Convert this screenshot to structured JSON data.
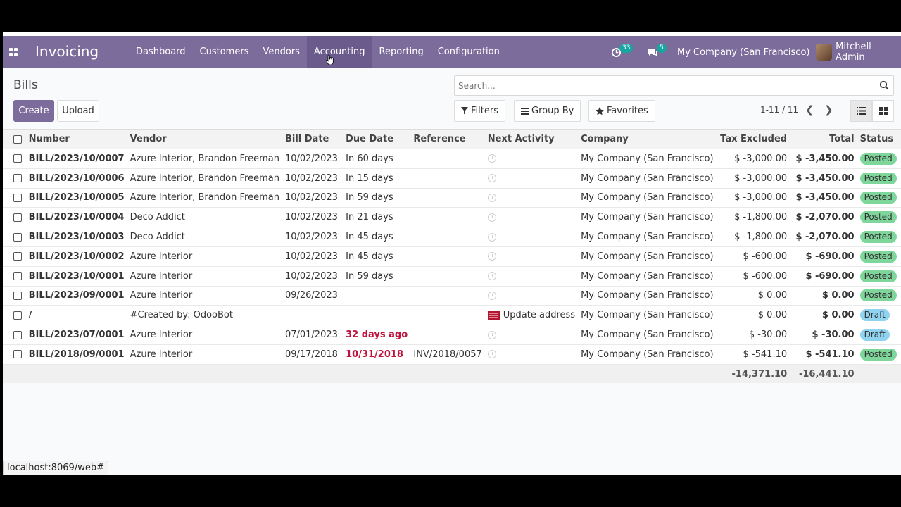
{
  "navbar": {
    "brand": "Invoicing",
    "menu": [
      "Dashboard",
      "Customers",
      "Vendors",
      "Accounting",
      "Reporting",
      "Configuration"
    ],
    "active_menu": "Accounting",
    "activity_count": "33",
    "message_count": "5",
    "company": "My Company (San Francisco)",
    "user": "Mitchell Admin",
    "accent": "#7c6c9c"
  },
  "control_panel": {
    "breadcrumb": "Bills",
    "create_label": "Create",
    "upload_label": "Upload",
    "search_placeholder": "Search...",
    "filters_label": "Filters",
    "group_by_label": "Group By",
    "favorites_label": "Favorites",
    "pager": "1-11 / 11"
  },
  "table": {
    "columns": [
      "Number",
      "Vendor",
      "Bill Date",
      "Due Date",
      "Reference",
      "Next Activity",
      "Company",
      "Tax Excluded",
      "Total",
      "Status"
    ],
    "rows": [
      {
        "number": "BILL/2023/10/0007",
        "vendor": "Azure Interior, Brandon Freeman",
        "bill_date": "10/02/2023",
        "due_date": "In 60 days",
        "due_overdue": false,
        "reference": "",
        "activity": "",
        "company": "My Company (San Francisco)",
        "tax_excluded": "$ -3,000.00",
        "total": "$ -3,450.00",
        "status": "Posted"
      },
      {
        "number": "BILL/2023/10/0006",
        "vendor": "Azure Interior, Brandon Freeman",
        "bill_date": "10/02/2023",
        "due_date": "In 15 days",
        "due_overdue": false,
        "reference": "",
        "activity": "",
        "company": "My Company (San Francisco)",
        "tax_excluded": "$ -3,000.00",
        "total": "$ -3,450.00",
        "status": "Posted"
      },
      {
        "number": "BILL/2023/10/0005",
        "vendor": "Azure Interior, Brandon Freeman",
        "bill_date": "10/02/2023",
        "due_date": "In 59 days",
        "due_overdue": false,
        "reference": "",
        "activity": "",
        "company": "My Company (San Francisco)",
        "tax_excluded": "$ -3,000.00",
        "total": "$ -3,450.00",
        "status": "Posted"
      },
      {
        "number": "BILL/2023/10/0004",
        "vendor": "Deco Addict",
        "bill_date": "10/02/2023",
        "due_date": "In 21 days",
        "due_overdue": false,
        "reference": "",
        "activity": "",
        "company": "My Company (San Francisco)",
        "tax_excluded": "$ -1,800.00",
        "total": "$ -2,070.00",
        "status": "Posted"
      },
      {
        "number": "BILL/2023/10/0003",
        "vendor": "Deco Addict",
        "bill_date": "10/02/2023",
        "due_date": "In 45 days",
        "due_overdue": false,
        "reference": "",
        "activity": "",
        "company": "My Company (San Francisco)",
        "tax_excluded": "$ -1,800.00",
        "total": "$ -2,070.00",
        "status": "Posted"
      },
      {
        "number": "BILL/2023/10/0002",
        "vendor": "Azure Interior",
        "bill_date": "10/02/2023",
        "due_date": "In 45 days",
        "due_overdue": false,
        "reference": "",
        "activity": "",
        "company": "My Company (San Francisco)",
        "tax_excluded": "$ -600.00",
        "total": "$ -690.00",
        "status": "Posted"
      },
      {
        "number": "BILL/2023/10/0001",
        "vendor": "Azure Interior",
        "bill_date": "10/02/2023",
        "due_date": "In 59 days",
        "due_overdue": false,
        "reference": "",
        "activity": "",
        "company": "My Company (San Francisco)",
        "tax_excluded": "$ -600.00",
        "total": "$ -690.00",
        "status": "Posted"
      },
      {
        "number": "BILL/2023/09/0001",
        "vendor": "Azure Interior",
        "bill_date": "09/26/2023",
        "due_date": "",
        "due_overdue": false,
        "reference": "",
        "activity": "",
        "company": "My Company (San Francisco)",
        "tax_excluded": "$ 0.00",
        "total": "$ 0.00",
        "status": "Posted"
      },
      {
        "number": "/",
        "vendor": "#Created by: OdooBot",
        "bill_date": "",
        "due_date": "",
        "due_overdue": false,
        "reference": "",
        "activity": "Update address",
        "company": "My Company (San Francisco)",
        "tax_excluded": "$ 0.00",
        "total": "$ 0.00",
        "status": "Draft"
      },
      {
        "number": "BILL/2023/07/0001",
        "vendor": "Azure Interior",
        "bill_date": "07/01/2023",
        "due_date": "32 days ago",
        "due_overdue": true,
        "reference": "",
        "activity": "",
        "company": "My Company (San Francisco)",
        "tax_excluded": "$ -30.00",
        "total": "$ -30.00",
        "status": "Draft"
      },
      {
        "number": "BILL/2018/09/0001",
        "vendor": "Azure Interior",
        "bill_date": "09/17/2018",
        "due_date": "10/31/2018",
        "due_overdue": true,
        "reference": "INV/2018/0057",
        "activity": "",
        "company": "My Company (San Francisco)",
        "tax_excluded": "$ -541.10",
        "total": "$ -541.10",
        "status": "Posted"
      }
    ],
    "totals": {
      "tax_excluded": "-14,371.10",
      "total": "-16,441.10"
    },
    "status_colors": {
      "Posted": "#7ed69b",
      "Draft": "#8fd3f0"
    },
    "overdue_color": "#c0143c"
  },
  "status_bar": "localhost:8069/web#"
}
